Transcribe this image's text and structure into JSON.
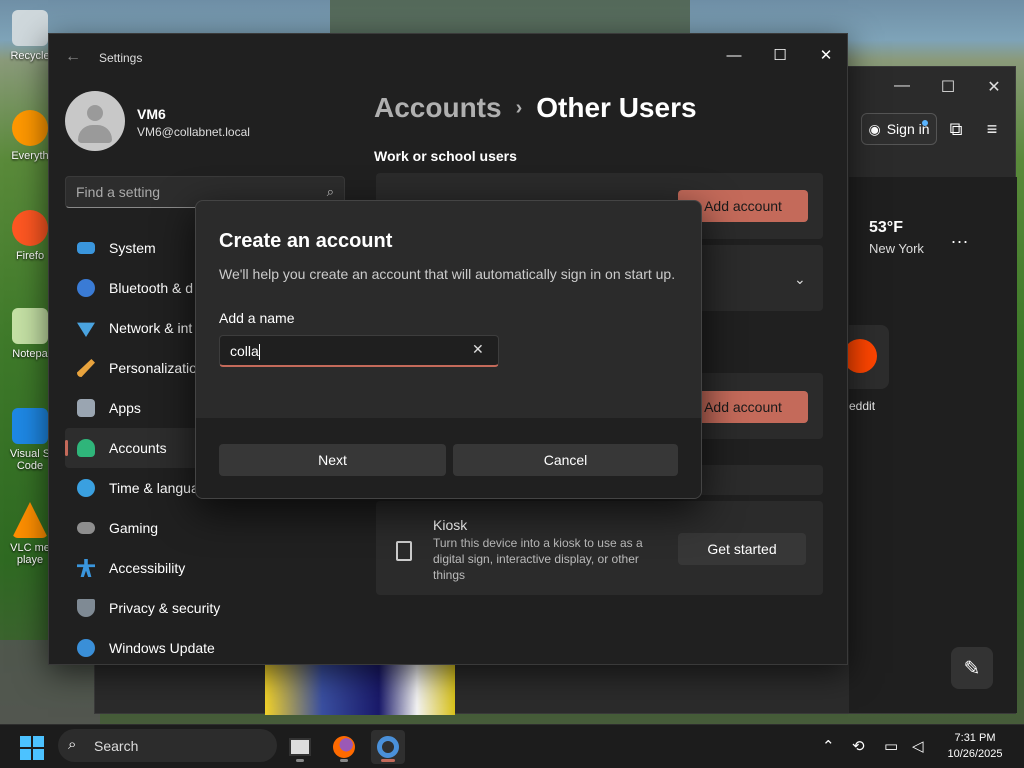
{
  "desktop": {
    "icons": [
      {
        "label": "Recycle",
        "color": "#cfd8dc"
      },
      {
        "label": "Everyth",
        "color": "#ff9800"
      },
      {
        "label": "Firefo",
        "color": "#ff5722"
      },
      {
        "label": "Notepa",
        "color": "#c5e1a5"
      },
      {
        "label": "Visual S Code",
        "color": "#1e88e5"
      },
      {
        "label": "VLC me playe",
        "color": "#ff8f00"
      }
    ]
  },
  "browser": {
    "sign_in_label": "Sign in",
    "weather_temp": "53°F",
    "weather_city": "New York",
    "weather_more": "...",
    "reddit_label": "eddit"
  },
  "settings": {
    "app_title": "Settings",
    "user": {
      "name": "VM6",
      "email": "VM6@collabnet.local"
    },
    "search_placeholder": "Find a setting",
    "nav": [
      {
        "label": "System",
        "icon": "monitor-icon",
        "color": "#3a96dd"
      },
      {
        "label": "Bluetooth & d",
        "icon": "bluetooth-icon",
        "color": "#3a7bd5"
      },
      {
        "label": "Network & int",
        "icon": "wifi-icon",
        "color": "#4aa3df"
      },
      {
        "label": "Personalizatio",
        "icon": "brush-icon",
        "color": "#e8a33d"
      },
      {
        "label": "Apps",
        "icon": "apps-icon",
        "color": "#9aa5b1"
      },
      {
        "label": "Accounts",
        "icon": "person-icon",
        "color": "#2fb57a",
        "active": true
      },
      {
        "label": "Time & langua",
        "icon": "globe-icon",
        "color": "#3aa0e0"
      },
      {
        "label": "Gaming",
        "icon": "gamepad-icon",
        "color": "#8e8e8e"
      },
      {
        "label": "Accessibility",
        "icon": "accessibility-icon",
        "color": "#3a96dd"
      },
      {
        "label": "Privacy & security",
        "icon": "shield-icon",
        "color": "#7f8a94"
      },
      {
        "label": "Windows Update",
        "icon": "update-icon",
        "color": "#3a8fd8"
      }
    ],
    "breadcrumb": {
      "parent": "Accounts",
      "separator": "›",
      "current": "Other Users"
    },
    "section_heading": "Work or school users",
    "add_account_label": "Add account",
    "add_account_label_2": "Add account",
    "kiosk": {
      "title": "Kiosk",
      "description": "Turn this device into a kiosk to use as a digital sign, interactive display, or other things",
      "button": "Get started"
    },
    "accent_color": "#c46a5a"
  },
  "dialog": {
    "title": "Create an account",
    "subtitle": "We'll help you create an account that will automatically sign in on start up.",
    "field_label": "Add a name",
    "field_value": "colla",
    "next_label": "Next",
    "cancel_label": "Cancel"
  },
  "taskbar": {
    "search_label": "Search",
    "time": "7:31 PM",
    "date": "10/26/2025"
  }
}
